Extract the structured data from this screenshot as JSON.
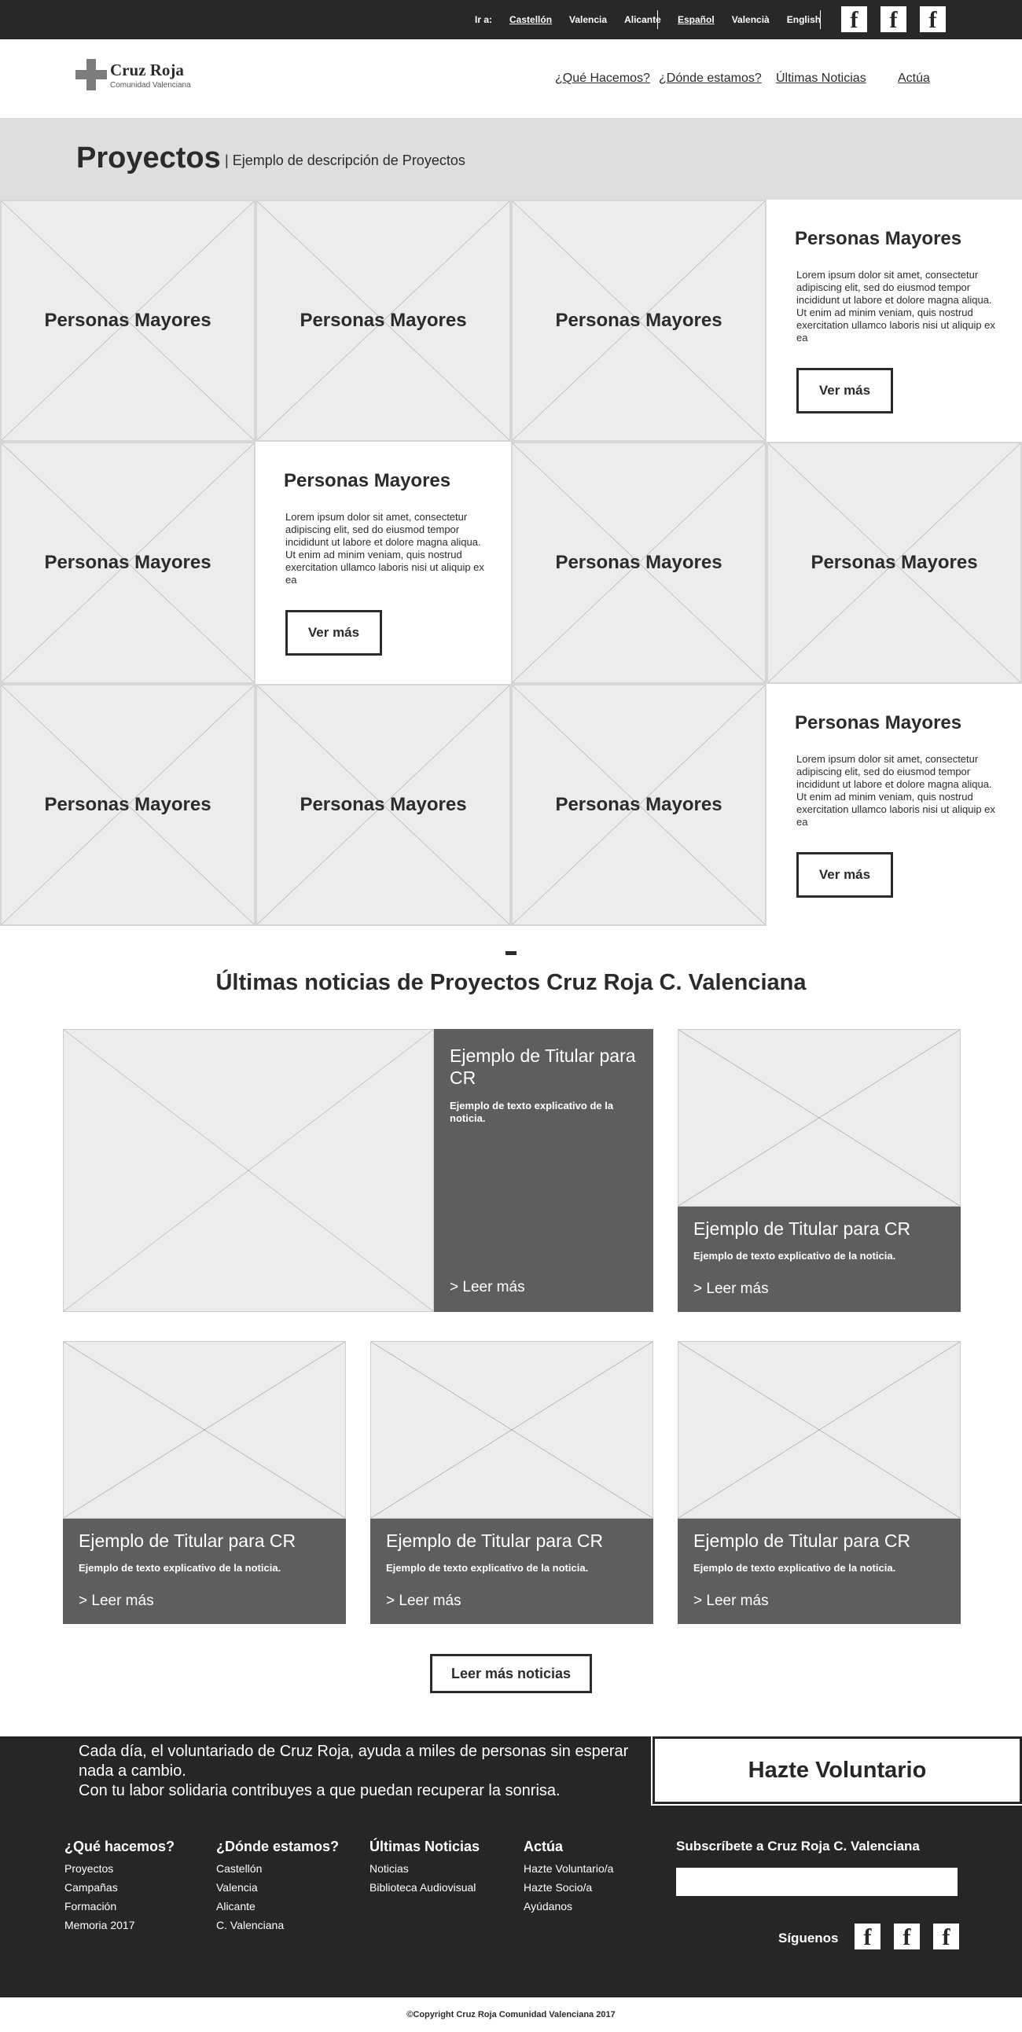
{
  "topbar": {
    "goto_label": "Ir a:",
    "goto_links": [
      "Castellón",
      "Valencia",
      "Alicante"
    ],
    "languages": [
      "Español",
      "Valencià",
      "English"
    ],
    "social_icons": [
      "facebook-icon",
      "facebook-icon",
      "facebook-icon"
    ],
    "social_glyph": "f"
  },
  "header": {
    "logo_title": "Cruz Roja",
    "logo_subtitle": "Comunidad Valenciana",
    "nav": [
      "¿Qué Hacemos?",
      "¿Dónde estamos?",
      "Últimas Noticias",
      "Actúa"
    ]
  },
  "banner": {
    "title": "Proyectos",
    "description": "Ejemplo de descripción de Proyectos"
  },
  "projects": {
    "tile_label": "Personas Mayores",
    "card_title": "Personas Mayores",
    "card_text": "Lorem ipsum dolor sit amet, consectetur adipiscing elit, sed do eiusmod tempor incididunt ut labore et dolore magna aliqua. Ut enim ad minim veniam, quis nostrud exercitation ullamco laboris nisi ut aliquip ex ea",
    "card_button": "Ver más"
  },
  "news": {
    "section_title": "Últimas noticias de Proyectos Cruz Roja C. Valenciana",
    "featured": {
      "title": "Ejemplo de Titular para CR",
      "text": "Ejemplo de texto explicativo de la noticia.",
      "link": "> Leer más"
    },
    "items": [
      {
        "title": "Ejemplo de Titular para CR",
        "text": "Ejemplo de texto explicativo de la noticia.",
        "link": "> Leer más"
      },
      {
        "title": "Ejemplo de Titular para CR",
        "text": "Ejemplo de texto explicativo de la noticia.",
        "link": "> Leer más"
      },
      {
        "title": "Ejemplo de Titular para CR",
        "text": "Ejemplo de texto explicativo de la noticia.",
        "link": "> Leer más"
      },
      {
        "title": "Ejemplo de Titular para CR",
        "text": "Ejemplo de texto explicativo de la noticia.",
        "link": "> Leer más"
      }
    ],
    "more_button": "Leer más noticias"
  },
  "footer": {
    "message_lines": [
      "Cada día, el voluntariado de Cruz Roja, ayuda a miles de personas sin esperar",
      "nada a cambio.",
      "Con tu labor solidaria contribuyes a que puedan recuperar la sonrisa."
    ],
    "volunteer_button": "Hazte Voluntario",
    "columns": [
      {
        "heading": "¿Qué hacemos?",
        "items": [
          "Proyectos",
          "Campañas",
          "Formación",
          "Memoria 2017"
        ]
      },
      {
        "heading": "¿Dónde estamos?",
        "items": [
          "Castellón",
          "Valencia",
          "Alicante",
          "C. Valenciana"
        ]
      },
      {
        "heading": "Últimas Noticias",
        "items": [
          "Noticias",
          "Biblioteca Audiovisual"
        ]
      },
      {
        "heading": "Actúa",
        "items": [
          "Hazte Voluntario/a",
          "Hazte Socio/a",
          "Ayúdanos"
        ]
      }
    ],
    "subscribe_label": "Subscríbete a Cruz Roja C. Valenciana",
    "subscribe_placeholder": "",
    "follow_label": "Síguenos",
    "social_glyph": "f",
    "copyright": "©Copyright Cruz Roja Comunidad Valenciana 2017"
  },
  "colors": {
    "dark": "#282828",
    "banner_bg": "#dedede",
    "placeholder_bg": "#ececec",
    "news_box": "#5e5e5e"
  }
}
